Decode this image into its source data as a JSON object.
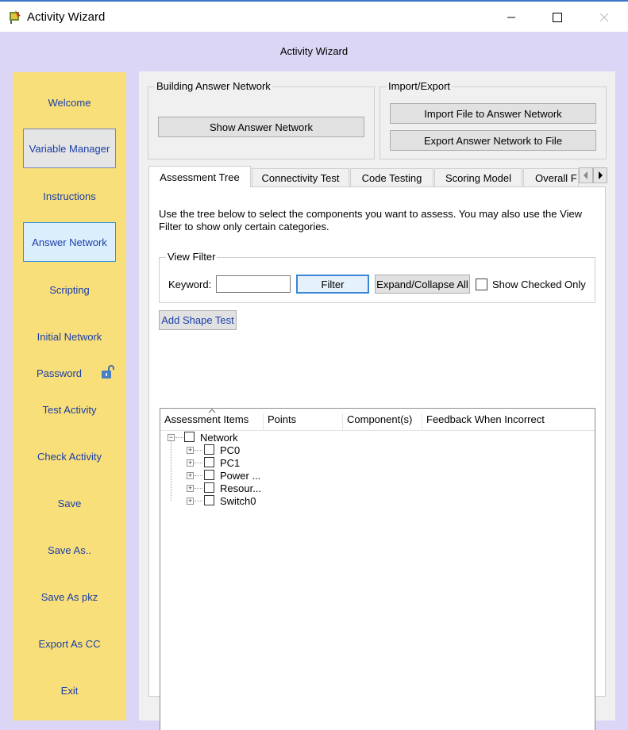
{
  "window": {
    "title": "Activity Wizard",
    "header": "Activity Wizard"
  },
  "sidebar": {
    "items": [
      {
        "label": "Welcome"
      },
      {
        "label": "Variable Manager"
      },
      {
        "label": "Instructions"
      },
      {
        "label": "Answer Network"
      },
      {
        "label": "Scripting"
      },
      {
        "label": "Initial Network"
      },
      {
        "label": "Password"
      },
      {
        "label": "Test Activity"
      },
      {
        "label": "Check Activity"
      },
      {
        "label": "Save"
      },
      {
        "label": "Save As.."
      },
      {
        "label": "Save As pkz"
      },
      {
        "label": "Export As CC"
      },
      {
        "label": "Exit"
      }
    ]
  },
  "building": {
    "title": "Building Answer Network",
    "show_button": "Show Answer Network"
  },
  "import_export": {
    "title": "Import/Export",
    "import_button": "Import File to Answer Network",
    "export_button": "Export Answer Network to File"
  },
  "tabs": [
    {
      "label": "Assessment Tree"
    },
    {
      "label": "Connectivity Test"
    },
    {
      "label": "Code Testing"
    },
    {
      "label": "Scoring Model"
    },
    {
      "label": "Overall F"
    }
  ],
  "assessment": {
    "instructions": "Use the tree below to select the components you want to assess. You may also use the View Filter to show only certain categories.",
    "view_filter": {
      "title": "View Filter",
      "keyword_label": "Keyword:",
      "keyword_value": "",
      "filter_button": "Filter",
      "expand_button": "Expand/Collapse All",
      "show_checked_label": "Show Checked Only"
    },
    "add_shape_button": "Add Shape Test",
    "columns": [
      "Assessment Items",
      "Points",
      "Component(s)",
      "Feedback When Incorrect"
    ],
    "tree": {
      "root": "Network",
      "children": [
        "PC0",
        "PC1",
        "Power ...",
        "Resour...",
        "Switch0"
      ]
    }
  },
  "colors": {
    "background": "#dbd6f5",
    "sidebar": "#f9df79",
    "link_text": "#1a3ea8",
    "focus_border": "#3a87d6"
  }
}
